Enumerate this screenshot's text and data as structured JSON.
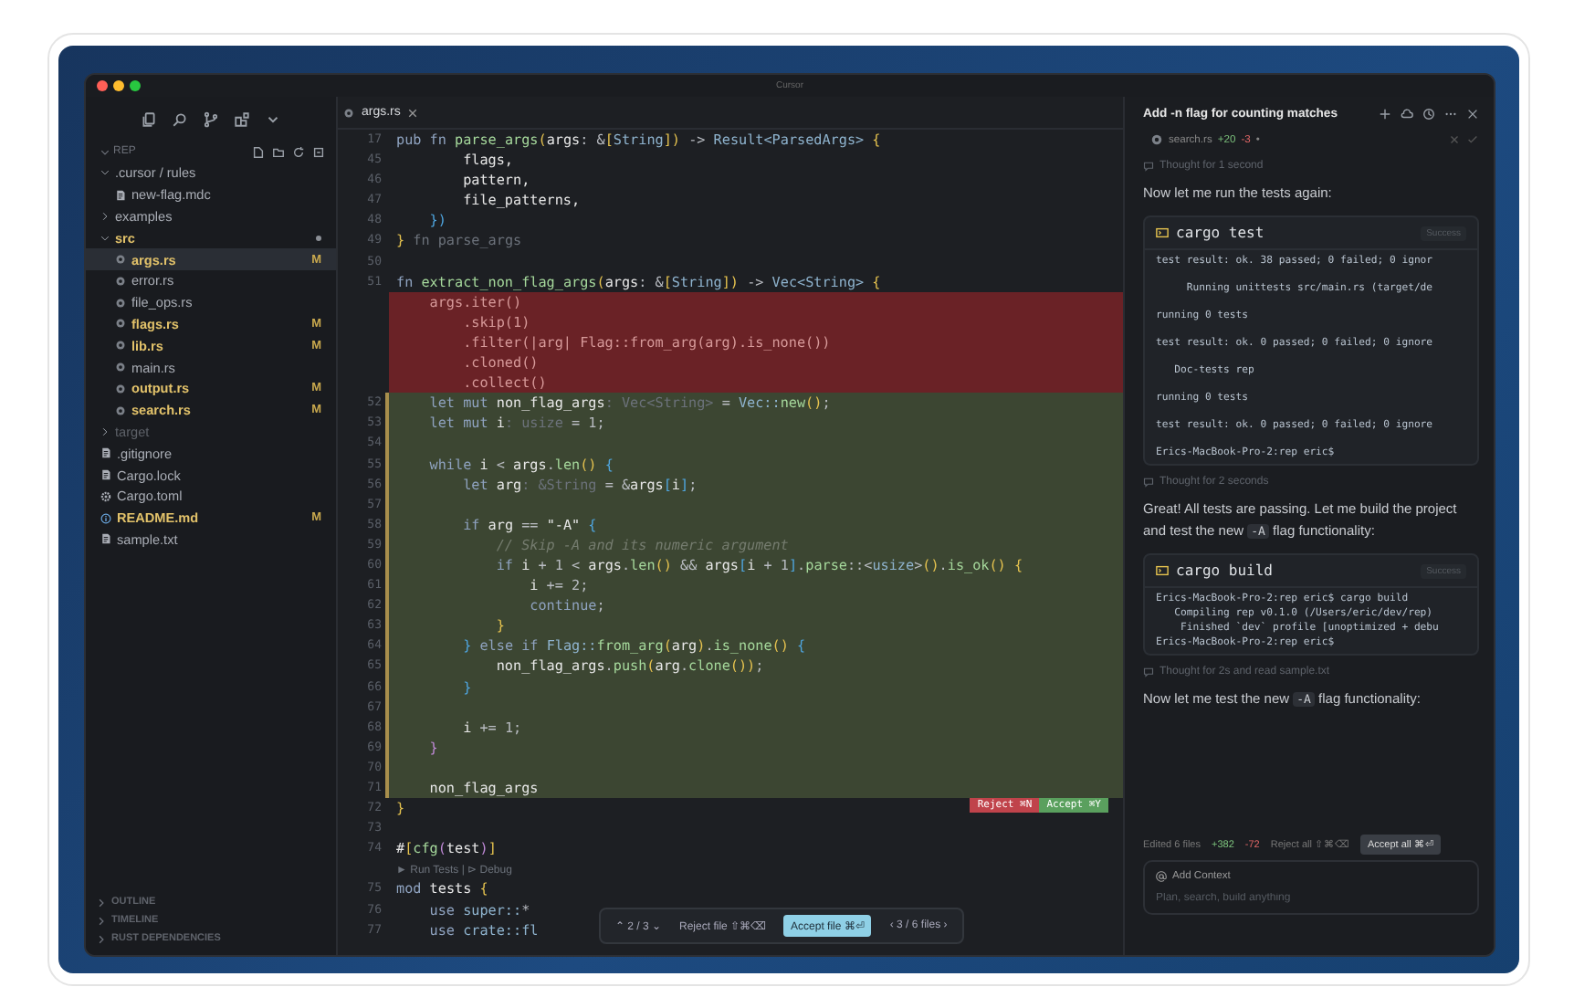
{
  "window": {
    "title": "Cursor"
  },
  "sidebar": {
    "folder": "REP",
    "tree": [
      {
        "name": ".cursor / rules",
        "kind": "folder",
        "expanded": true,
        "modified": false,
        "children": [
          {
            "name": "new-flag.mdc",
            "kind": "file",
            "modified": false
          }
        ]
      },
      {
        "name": "examples",
        "kind": "folder",
        "expanded": false,
        "modified": false
      },
      {
        "name": "src",
        "kind": "folder",
        "expanded": true,
        "modified": true,
        "children": [
          {
            "name": "args.rs",
            "kind": "rust",
            "modified": true,
            "badge": "M",
            "selected": true
          },
          {
            "name": "error.rs",
            "kind": "rust",
            "modified": false,
            "selected": false
          },
          {
            "name": "file_ops.rs",
            "kind": "rust",
            "modified": false,
            "selected": false
          },
          {
            "name": "flags.rs",
            "kind": "rust",
            "modified": true,
            "badge": "M",
            "selected": false
          },
          {
            "name": "lib.rs",
            "kind": "rust",
            "modified": true,
            "badge": "M",
            "selected": false
          },
          {
            "name": "main.rs",
            "kind": "rust",
            "modified": false,
            "selected": false
          },
          {
            "name": "output.rs",
            "kind": "rust",
            "modified": true,
            "badge": "M",
            "selected": false
          },
          {
            "name": "search.rs",
            "kind": "rust",
            "modified": true,
            "badge": "M",
            "selected": false
          }
        ]
      },
      {
        "name": "target",
        "kind": "folder",
        "expanded": false,
        "modified": false,
        "ignored": true
      },
      {
        "name": ".gitignore",
        "kind": "file",
        "modified": false
      },
      {
        "name": "Cargo.lock",
        "kind": "file",
        "modified": false
      },
      {
        "name": "Cargo.toml",
        "kind": "gear",
        "modified": false
      },
      {
        "name": "README.md",
        "kind": "info",
        "modified": true,
        "badge": "M"
      },
      {
        "name": "sample.txt",
        "kind": "file",
        "modified": false
      }
    ],
    "panels": [
      "OUTLINE",
      "TIMELINE",
      "RUST DEPENDENCIES"
    ]
  },
  "editor": {
    "tabs": [
      {
        "label": "args.rs",
        "selected": true
      }
    ],
    "lines": [
      {
        "num": "17",
        "kind": "sticky",
        "tokens": [
          {
            "kind": "kw",
            "text": "pub fn "
          },
          {
            "kind": "fn",
            "text": "parse_args"
          },
          {
            "kind": "p",
            "text": "("
          },
          {
            "kind": "id",
            "text": "args"
          },
          {
            "kind": "t",
            "text": ": &"
          },
          {
            "kind": "p",
            "text": "["
          },
          {
            "kind": "ty",
            "text": "String"
          },
          {
            "kind": "p",
            "text": "])"
          },
          {
            "kind": "t",
            "text": " -> "
          },
          {
            "kind": "ty",
            "text": "Result<ParsedArgs>"
          },
          {
            "kind": "p",
            "text": " {"
          }
        ]
      },
      {
        "num": "45",
        "kind": "normal",
        "tokens": [
          {
            "kind": "id",
            "text": "        flags,"
          }
        ]
      },
      {
        "num": "46",
        "kind": "normal",
        "tokens": [
          {
            "kind": "id",
            "text": "        pattern,"
          }
        ]
      },
      {
        "num": "47",
        "kind": "normal",
        "tokens": [
          {
            "kind": "id",
            "text": "        file_patterns,"
          }
        ]
      },
      {
        "num": "48",
        "kind": "normal",
        "tokens": [
          {
            "kind": "b",
            "text": "    })"
          }
        ]
      },
      {
        "num": "49",
        "kind": "normal",
        "tokens": [
          {
            "kind": "p",
            "text": "}"
          },
          {
            "kind": "h",
            "text": " fn parse_args"
          }
        ]
      },
      {
        "num": "50",
        "kind": "normal"
      },
      {
        "num": "51",
        "kind": "normal",
        "tokens": [
          {
            "kind": "kw",
            "text": "fn "
          },
          {
            "kind": "fn",
            "text": "extract_non_flag_args"
          },
          {
            "kind": "p",
            "text": "("
          },
          {
            "kind": "id",
            "text": "args"
          },
          {
            "kind": "t",
            "text": ": &"
          },
          {
            "kind": "p",
            "text": "["
          },
          {
            "kind": "ty",
            "text": "String"
          },
          {
            "kind": "p",
            "text": "])"
          },
          {
            "kind": "t",
            "text": " -> "
          },
          {
            "kind": "ty",
            "text": "Vec<String>"
          },
          {
            "kind": "p",
            "text": " {"
          }
        ]
      },
      {
        "kind": "deleted",
        "tokens": [
          {
            "kind": "d",
            "text": "    args.iter()"
          }
        ]
      },
      {
        "kind": "deleted",
        "tokens": [
          {
            "kind": "d",
            "text": "        .skip(1)"
          }
        ]
      },
      {
        "kind": "deleted",
        "tokens": [
          {
            "kind": "d",
            "text": "        .filter(|arg| Flag::from_arg(arg).is_none())"
          }
        ]
      },
      {
        "kind": "deleted",
        "tokens": [
          {
            "kind": "d",
            "text": "        .cloned()"
          }
        ]
      },
      {
        "kind": "deleted",
        "tokens": [
          {
            "kind": "d",
            "text": "        .collect()"
          }
        ]
      },
      {
        "num": "52",
        "kind": "added",
        "tokens": [
          {
            "kind": "kw",
            "text": "    let mut "
          },
          {
            "kind": "id",
            "text": "non_flag_args"
          },
          {
            "kind": "h",
            "text": ": Vec<String>"
          },
          {
            "kind": "t",
            "text": " = "
          },
          {
            "kind": "ty",
            "text": "Vec::"
          },
          {
            "kind": "fn",
            "text": "new"
          },
          {
            "kind": "p",
            "text": "()"
          },
          {
            "kind": "t",
            "text": ";"
          }
        ]
      },
      {
        "num": "53",
        "kind": "added",
        "tokens": [
          {
            "kind": "kw",
            "text": "    let mut "
          },
          {
            "kind": "id",
            "text": "i"
          },
          {
            "kind": "h",
            "text": ": usize"
          },
          {
            "kind": "t",
            "text": " = 1;"
          }
        ]
      },
      {
        "num": "54",
        "kind": "added"
      },
      {
        "num": "55",
        "kind": "added",
        "tokens": [
          {
            "kind": "kw",
            "text": "    while "
          },
          {
            "kind": "id",
            "text": "i"
          },
          {
            "kind": "t",
            "text": " < "
          },
          {
            "kind": "id",
            "text": "args"
          },
          {
            "kind": "t",
            "text": "."
          },
          {
            "kind": "fn",
            "text": "len"
          },
          {
            "kind": "p",
            "text": "()"
          },
          {
            "kind": "b",
            "text": " {"
          }
        ]
      },
      {
        "num": "56",
        "kind": "added",
        "tokens": [
          {
            "kind": "kw",
            "text": "        let "
          },
          {
            "kind": "id",
            "text": "arg"
          },
          {
            "kind": "h",
            "text": ": &String"
          },
          {
            "kind": "t",
            "text": " = &"
          },
          {
            "kind": "id",
            "text": "args"
          },
          {
            "kind": "b",
            "text": "["
          },
          {
            "kind": "id",
            "text": "i"
          },
          {
            "kind": "b",
            "text": "]"
          },
          {
            "kind": "t",
            "text": ";"
          }
        ]
      },
      {
        "num": "57",
        "kind": "added"
      },
      {
        "num": "58",
        "kind": "added",
        "tokens": [
          {
            "kind": "kw",
            "text": "        if "
          },
          {
            "kind": "id",
            "text": "arg"
          },
          {
            "kind": "t",
            "text": " == "
          },
          {
            "kind": "s",
            "text": "\"-A\""
          },
          {
            "kind": "b",
            "text": " {"
          }
        ]
      },
      {
        "num": "59",
        "kind": "added",
        "tokens": [
          {
            "kind": "c",
            "text": "            // Skip -A and its numeric argument"
          }
        ]
      },
      {
        "num": "60",
        "kind": "added",
        "tokens": [
          {
            "kind": "kw",
            "text": "            if "
          },
          {
            "kind": "id",
            "text": "i"
          },
          {
            "kind": "t",
            "text": " + 1 < "
          },
          {
            "kind": "id",
            "text": "args"
          },
          {
            "kind": "t",
            "text": "."
          },
          {
            "kind": "fn",
            "text": "len"
          },
          {
            "kind": "p",
            "text": "()"
          },
          {
            "kind": "t",
            "text": " && "
          },
          {
            "kind": "id",
            "text": "args"
          },
          {
            "kind": "b",
            "text": "["
          },
          {
            "kind": "id",
            "text": "i"
          },
          {
            "kind": "t",
            "text": " + 1"
          },
          {
            "kind": "b",
            "text": "]"
          },
          {
            "kind": "t",
            "text": "."
          },
          {
            "kind": "fn",
            "text": "parse"
          },
          {
            "kind": "t",
            "text": "::<"
          },
          {
            "kind": "ty",
            "text": "usize"
          },
          {
            "kind": "t",
            "text": ">"
          },
          {
            "kind": "p",
            "text": "()"
          },
          {
            "kind": "t",
            "text": "."
          },
          {
            "kind": "fn",
            "text": "is_ok"
          },
          {
            "kind": "p",
            "text": "() {"
          }
        ]
      },
      {
        "num": "61",
        "kind": "added",
        "tokens": [
          {
            "kind": "id",
            "text": "                i"
          },
          {
            "kind": "t",
            "text": " += 2;"
          }
        ]
      },
      {
        "num": "62",
        "kind": "added",
        "tokens": [
          {
            "kind": "kw",
            "text": "                continue"
          },
          {
            "kind": "t",
            "text": ";"
          }
        ]
      },
      {
        "num": "63",
        "kind": "added",
        "tokens": [
          {
            "kind": "p",
            "text": "            }"
          }
        ]
      },
      {
        "num": "64",
        "kind": "added",
        "tokens": [
          {
            "kind": "b",
            "text": "        }"
          },
          {
            "kind": "kw",
            "text": " else if "
          },
          {
            "kind": "ty",
            "text": "Flag::"
          },
          {
            "kind": "fn",
            "text": "from_arg"
          },
          {
            "kind": "p",
            "text": "("
          },
          {
            "kind": "id",
            "text": "arg"
          },
          {
            "kind": "p",
            "text": ")"
          },
          {
            "kind": "t",
            "text": "."
          },
          {
            "kind": "fn",
            "text": "is_none"
          },
          {
            "kind": "p",
            "text": "()"
          },
          {
            "kind": "b",
            "text": " {"
          }
        ]
      },
      {
        "num": "65",
        "kind": "added",
        "tokens": [
          {
            "kind": "id",
            "text": "            non_flag_args"
          },
          {
            "kind": "t",
            "text": "."
          },
          {
            "kind": "fn",
            "text": "push"
          },
          {
            "kind": "p",
            "text": "("
          },
          {
            "kind": "id",
            "text": "arg"
          },
          {
            "kind": "t",
            "text": "."
          },
          {
            "kind": "fn",
            "text": "clone"
          },
          {
            "kind": "p",
            "text": "())"
          },
          {
            "kind": "t",
            "text": ";"
          }
        ]
      },
      {
        "num": "66",
        "kind": "added",
        "tokens": [
          {
            "kind": "b",
            "text": "        }"
          }
        ]
      },
      {
        "num": "67",
        "kind": "added"
      },
      {
        "num": "68",
        "kind": "added",
        "tokens": [
          {
            "kind": "id",
            "text": "        i"
          },
          {
            "kind": "t",
            "text": " += 1;"
          }
        ]
      },
      {
        "num": "69",
        "kind": "added",
        "tokens": [
          {
            "kind": "m",
            "text": "    }"
          }
        ]
      },
      {
        "num": "70",
        "kind": "added"
      },
      {
        "num": "71",
        "kind": "added",
        "tokens": [
          {
            "kind": "id",
            "text": "    non_flag_args"
          }
        ]
      },
      {
        "num": "72",
        "kind": "hunkend",
        "tokens": [
          {
            "kind": "p",
            "text": "}"
          }
        ]
      },
      {
        "num": "73",
        "kind": "normal"
      },
      {
        "num": "74",
        "kind": "normal",
        "tokens": [
          {
            "kind": "id",
            "text": "#"
          },
          {
            "kind": "p",
            "text": "["
          },
          {
            "kind": "fn",
            "text": "cfg"
          },
          {
            "kind": "m",
            "text": "("
          },
          {
            "kind": "id",
            "text": "test"
          },
          {
            "kind": "m",
            "text": ")"
          },
          {
            "kind": "p",
            "text": "]"
          }
        ]
      },
      {
        "kind": "lens",
        "tokens": [
          {
            "kind": "h",
            "text": "► Run Tests | ⊳ Debug"
          }
        ]
      },
      {
        "num": "75",
        "kind": "normal",
        "tokens": [
          {
            "kind": "kw",
            "text": "mod "
          },
          {
            "kind": "id",
            "text": "tests"
          },
          {
            "kind": "p",
            "text": " {"
          }
        ]
      },
      {
        "num": "76",
        "kind": "normal",
        "tokens": [
          {
            "kind": "kw",
            "text": "    use "
          },
          {
            "kind": "ty",
            "text": "super::"
          },
          {
            "kind": "t",
            "text": "*"
          }
        ]
      },
      {
        "num": "77",
        "kind": "normal",
        "tokens": [
          {
            "kind": "kw",
            "text": "    use "
          },
          {
            "kind": "ty",
            "text": "crate::fl"
          }
        ]
      }
    ],
    "hunk_actions": {
      "reject": "Reject ⌘N",
      "accept": "Accept ⌘Y"
    },
    "review_bar": {
      "hunks": "⌃ 2 / 3 ⌄",
      "reject_file": "Reject file ⇧⌘⌫",
      "accept_file": "Accept file ⌘⏎",
      "files": "‹ 3 / 6 files ›"
    }
  },
  "chat": {
    "title": "Add -n flag for counting matches",
    "file": {
      "name": "search.rs",
      "added": "+20",
      "removed": "-3",
      "dot": "•"
    },
    "messages": [
      {
        "kind": "thought",
        "text": "Thought for 1 second"
      },
      {
        "kind": "text",
        "before": "Now let me run the tests again:"
      },
      {
        "kind": "terminal",
        "command": "cargo test",
        "badge": "Success",
        "output": [
          "test result: ok. 38 passed; 0 failed; 0 ignor",
          "     Running unittests src/main.rs (target/de",
          "running 0 tests",
          "test result: ok. 0 passed; 0 failed; 0 ignore",
          "   Doc-tests rep",
          "running 0 tests",
          "test result: ok. 0 passed; 0 failed; 0 ignore",
          "Erics-MacBook-Pro-2:rep eric$"
        ]
      },
      {
        "kind": "thought",
        "text": "Thought for 2 seconds"
      },
      {
        "kind": "text",
        "before": "Great! All tests are passing. Let me build the project and test the new ",
        "code": "-A",
        "after": " flag functionality:"
      },
      {
        "kind": "terminal",
        "command": "cargo build",
        "badge": "Success",
        "output": [
          "Erics-MacBook-Pro-2:rep eric$ cargo build",
          "   Compiling rep v0.1.0 (/Users/eric/dev/rep)",
          "    Finished `dev` profile [unoptimized + debu",
          "Erics-MacBook-Pro-2:rep eric$"
        ]
      },
      {
        "kind": "thought",
        "text": "Thought for 2s and read sample.txt"
      },
      {
        "kind": "text",
        "before": "Now let me test the new ",
        "code": "-A",
        "after": " flag functionality:"
      }
    ],
    "edited": {
      "summary": "Edited 6 files",
      "added": "+382",
      "removed": "-72",
      "reject": "Reject all ⇧⌘⌫",
      "accept": "Accept all ⌘⏎"
    },
    "composer": {
      "context": "Add Context",
      "placeholder": "Plan, search, build anything"
    }
  }
}
